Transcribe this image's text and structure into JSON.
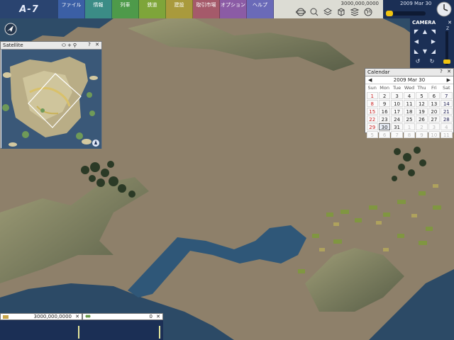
{
  "app": {
    "logo": "A-7"
  },
  "menu": [
    "ファイル",
    "情報",
    "列車",
    "鉄道",
    "建設",
    "取引市場",
    "オプション",
    "ヘルプ"
  ],
  "menu_colors": [
    "#3b5fa5",
    "#3b8c86",
    "#4e9a4a",
    "#7ea53a",
    "#a99a3c",
    "#a55a6a",
    "#8b5ba5",
    "#6a6ab8"
  ],
  "toolbar": {
    "funds": "3000,000,0000",
    "icons": [
      "globe-icon",
      "magnifier-icon",
      "layers-icon",
      "cube-icon",
      "stack-icon",
      "world-icon"
    ]
  },
  "datetime": {
    "date": "2009  Mar  30"
  },
  "satellite": {
    "title": "Satellite"
  },
  "window": {
    "help": "?",
    "close": "✕"
  },
  "camera": {
    "title": "CAMERA",
    "close": "✕",
    "zoom_label": "Z",
    "up": "▲",
    "down": "▼",
    "left": "◀",
    "right": "▶",
    "rotate_left": "↺",
    "rotate_right": "↻"
  },
  "calendar": {
    "title": "Calendar",
    "prev": "◀",
    "next": "▶",
    "month_label": "2009  Mar  30",
    "weekdays": [
      "Sun",
      "Mon",
      "Tue",
      "Wed",
      "Thu",
      "Fri",
      "Sat"
    ],
    "weeks": [
      [
        "1",
        "2",
        "3",
        "4",
        "5",
        "6",
        "7"
      ],
      [
        "8",
        "9",
        "10",
        "11",
        "12",
        "13",
        "14"
      ],
      [
        "15",
        "16",
        "17",
        "18",
        "19",
        "20",
        "21"
      ],
      [
        "22",
        "23",
        "24",
        "25",
        "26",
        "27",
        "28"
      ],
      [
        "29",
        "30",
        "31",
        "1",
        "2",
        "3",
        "4"
      ],
      [
        "5",
        "6",
        "7",
        "8",
        "9",
        "10",
        "11"
      ]
    ],
    "today": "30"
  },
  "status": {
    "money": "3000,000,0000",
    "population": "0",
    "close": "✕"
  }
}
